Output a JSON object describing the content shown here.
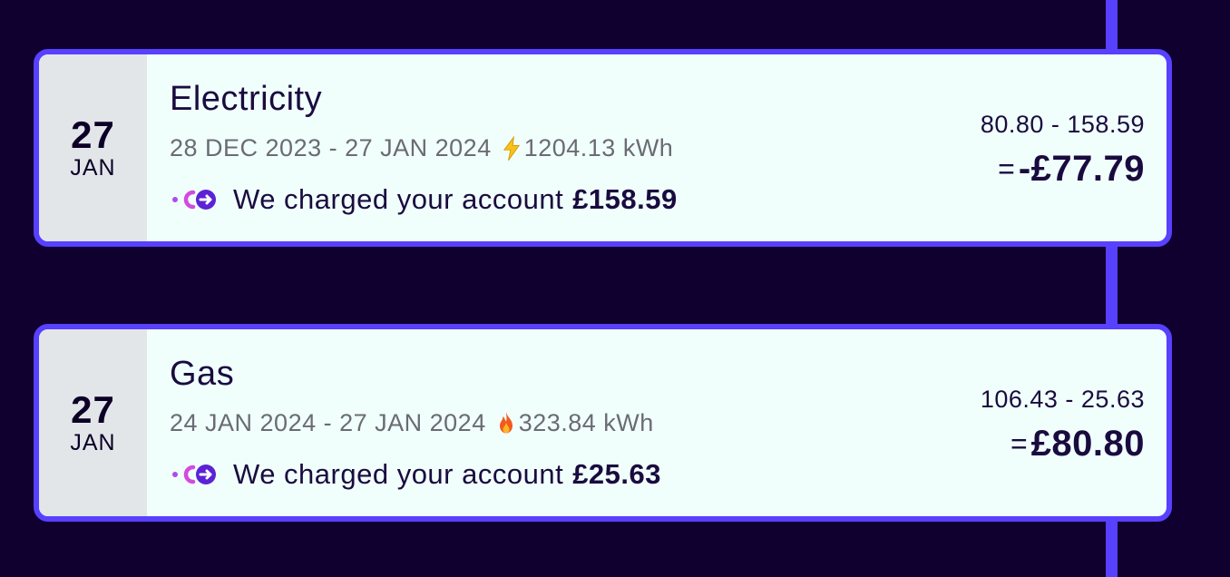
{
  "statements": [
    {
      "date_day": "27",
      "date_month": "JAN",
      "title": "Electricity",
      "period": "28 DEC 2023 - 27 JAN 2024",
      "energy_icon": "lightning-icon",
      "usage": "1204.13 kWh",
      "charge_text": "We charged your account",
      "charge_amount": "£158.59",
      "calc_expression": "80.80 - 158.59",
      "calc_equals": "=",
      "calc_total": "-£77.79"
    },
    {
      "date_day": "27",
      "date_month": "JAN",
      "title": "Gas",
      "period": "24 JAN 2024 - 27 JAN 2024",
      "energy_icon": "flame-icon",
      "usage": "323.84 kWh",
      "charge_text": "We charged your account",
      "charge_amount": "£25.63",
      "calc_expression": "106.43 - 25.63",
      "calc_equals": "=",
      "calc_total": "£80.80"
    }
  ],
  "colors": {
    "background": "#100030",
    "accent": "#5840ff",
    "card": "#f0fffc",
    "date_panel": "#e3e6e9",
    "text": "#1a0b3f",
    "muted": "#6b6b73"
  }
}
